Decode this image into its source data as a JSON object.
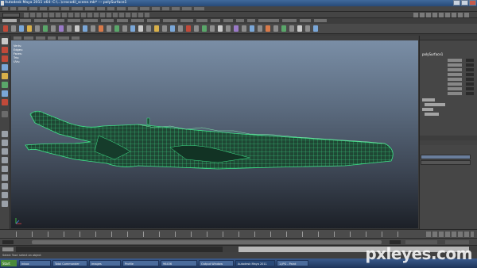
{
  "window": {
    "title": "Autodesk Maya 2011 x64: C:\\...\\crocodil_scene.mb* --- polySurface1"
  },
  "hud": {
    "rows": [
      "Verts:",
      "Edges:",
      "Faces:",
      "Tris:",
      "UVs:"
    ]
  },
  "channel_box": {
    "object_name": "polySurface1"
  },
  "help_line": {
    "text": "Select Tool: select an object"
  },
  "taskbar": {
    "start_label": "Start",
    "tasks": [
      "Inbox",
      "Total Commander",
      "images",
      "Profile",
      "96436",
      "Output Window",
      "Autodesk Maya 2011",
      "1.JPG - Paint"
    ]
  },
  "watermark": {
    "text": "pxleyes.com"
  },
  "colors": {
    "wireframe": "#3fe58a",
    "mesh_dark": "#1f4734",
    "viewport_top": "#7a8ea6",
    "viewport_bottom": "#1c2027"
  }
}
